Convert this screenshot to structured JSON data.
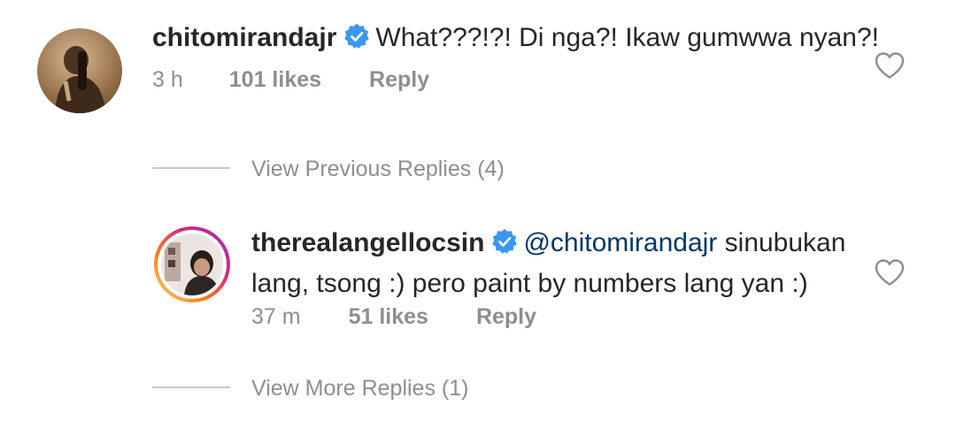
{
  "comment1": {
    "username": "chitomirandajr",
    "verified_icon": "verified-badge-icon",
    "text": "What???!?! Di nga?! Ikaw gumwwa nyan?!",
    "time": "3 h",
    "likes": "101 likes",
    "reply_label": "Reply",
    "like_icon": "heart-outline-icon"
  },
  "previous_replies": {
    "label": "View Previous Replies (4)"
  },
  "comment2": {
    "username": "therealangellocsin",
    "verified_icon": "verified-badge-icon",
    "mention": "@chitomirandajr",
    "text_line1_rest": " sinubukan",
    "text_line2": "lang, tsong :) pero paint by numbers lang yan :)",
    "time": "37 m",
    "likes": "51 likes",
    "reply_label": "Reply",
    "like_icon": "heart-outline-icon",
    "story_ring_colors": [
      "#feda75",
      "#fa7e1e",
      "#d62976",
      "#962fbf"
    ]
  },
  "more_replies": {
    "label": "View More Replies (1)"
  },
  "colors": {
    "verified_blue": "#3897f0",
    "mention_blue": "#00376b",
    "meta_gray": "#8e8e8e",
    "text_dark": "#262626"
  }
}
